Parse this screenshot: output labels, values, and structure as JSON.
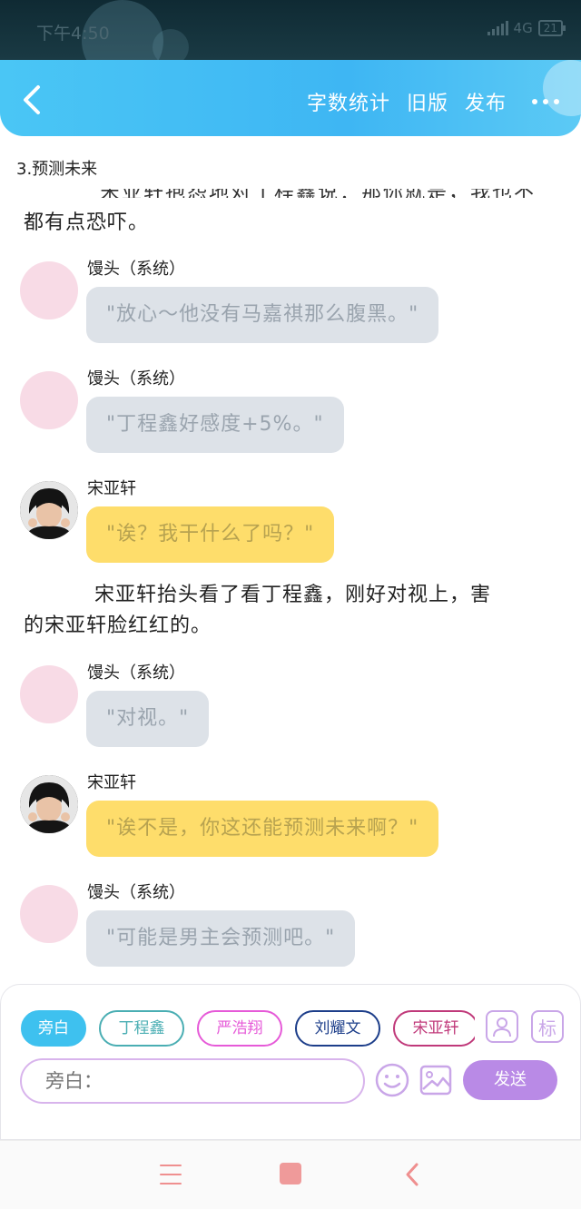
{
  "status_bar": {
    "time": "下午4:50",
    "network": "4G",
    "battery": "21"
  },
  "header": {
    "actions": [
      "字数统计",
      "旧版",
      "发布"
    ]
  },
  "chapter_title": "3.预测未来",
  "cut_line": "宋亚轩抱怨地对丁程鑫说：那你就是，我也不",
  "narration_1": "都有点恐吓。",
  "messages": [
    {
      "name": "馒头（系统）",
      "text": "\"放心～他没有马嘉祺那么腹黑。\"",
      "style": "grey"
    },
    {
      "name": "馒头（系统）",
      "text": "\"丁程鑫好感度+5%。\"",
      "style": "grey"
    },
    {
      "name": "宋亚轩",
      "text": "\"诶？我干什么了吗？\"",
      "style": "yellow"
    },
    {
      "name": "馒头（系统）",
      "text": "\"对视。\"",
      "style": "grey"
    },
    {
      "name": "宋亚轩",
      "text": "\"诶不是，你这还能预测未来啊？\"",
      "style": "yellow"
    },
    {
      "name": "馒头（系统）",
      "text": "\"可能是男主会预测吧。\"",
      "style": "grey"
    }
  ],
  "narration_2_line1": "宋亚轩抬头看了看丁程鑫，刚好对视上，害",
  "narration_2_line2": "的宋亚轩脸红红的。",
  "roles": [
    {
      "label": "旁白",
      "color": "#3ec1ef"
    },
    {
      "label": "丁程鑫",
      "color": "#4aaeb3"
    },
    {
      "label": "严浩翔",
      "color": "#e65ad8"
    },
    {
      "label": "刘耀文",
      "color": "#1d3e8a"
    },
    {
      "label": "宋亚轩",
      "color": "#c0397a"
    }
  ],
  "input": {
    "placeholder": "旁白：",
    "value": ""
  },
  "send_label": "发送",
  "mark_label": "标"
}
